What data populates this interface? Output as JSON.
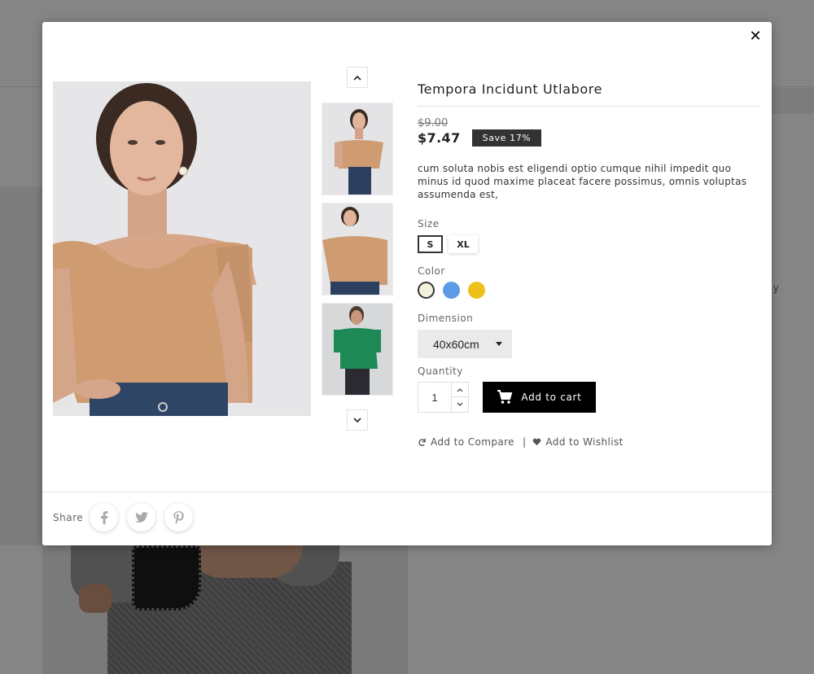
{
  "modal": {
    "close_symbol": "✕",
    "product": {
      "title": "Tempora Incidunt Utlabore",
      "old_price": "$9.00",
      "price": "$7.47",
      "discount_badge": "Save 17%",
      "description": "cum soluta nobis est eligendi optio cumque nihil impedit quo minus id quod maxime placeat facere possimus, omnis voluptas assumenda est,"
    },
    "size": {
      "label": "Size",
      "options": [
        "S",
        "XL"
      ],
      "selected": "S"
    },
    "color": {
      "label": "Color",
      "swatches": [
        "#f4f1dc",
        "#5b9be8",
        "#eec01a"
      ],
      "selected_index": 0
    },
    "dimension": {
      "label": "Dimension",
      "selected": "40x60cm"
    },
    "quantity": {
      "label": "Quantity",
      "value": "1"
    },
    "add_to_cart_label": "Add to cart",
    "compare_label": "Add to Compare",
    "separator": "|",
    "wishlist_label": "Add to Wishlist",
    "share": {
      "label": "Share",
      "networks": [
        "facebook-icon",
        "twitter-icon",
        "pinterest-icon"
      ]
    }
  },
  "background": {
    "fragment_text": "y"
  },
  "colors": {
    "accent": "#000000",
    "badge": "#333333"
  }
}
